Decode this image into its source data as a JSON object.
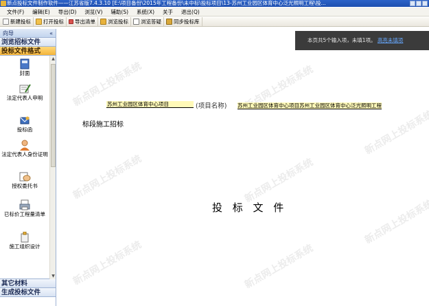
{
  "window": {
    "title": "新点投标文件制作软件——江苏省版7.4.3.10        [E:\\项目备份\\2015年工程备份\\未中标\\投标项目\\13-苏州工业园区体育中心泛光照明工程\\投..."
  },
  "menu": [
    "文件(F)",
    "编辑(E)",
    "导出(D)",
    "浏览(V)",
    "辅助(S)",
    "系统(X)",
    "关于",
    "退出(Q)"
  ],
  "toolbar": {
    "new_bid": "新建投标",
    "open_bid": "打开投标",
    "export_list": "导出清单",
    "browse_bid": "浏览投标",
    "browse_answer": "浏览答疑",
    "sync_bid_list": "同步投标库"
  },
  "nav": {
    "header": "向导",
    "collapse": "«",
    "categories": {
      "browse_tender": "浏览招标文件",
      "bid_format": "投标文件格式",
      "other_materials": "其它材料",
      "generate_bid": "生成投标文件"
    },
    "items": [
      {
        "label": "封面",
        "icon": "book-cover-icon"
      },
      {
        "label": "法定代表人申明",
        "icon": "document-pen-icon"
      },
      {
        "label": "投标函",
        "icon": "envelope-icon"
      },
      {
        "label": "法定代表人身份证明",
        "icon": "person-id-icon"
      },
      {
        "label": "授权委托书",
        "icon": "handshake-icon"
      },
      {
        "label": "已标价工程量清单",
        "icon": "printer-list-icon"
      },
      {
        "label": "施工组织设计",
        "icon": "package-icon"
      }
    ]
  },
  "notice": {
    "text": "本页共5个输入项，未填1项。",
    "link": "高亮未填项"
  },
  "document": {
    "project_name_short": "苏州工业园区体育中心项目",
    "project_label": "(项目名称)",
    "project_name_full": "苏州工业园区体育中心项目苏州工业园区体育中心泛光照明工程",
    "bid_section": "标段施工招标",
    "title": "投 标 文 件"
  },
  "watermark_text": "新点网上投标系统"
}
